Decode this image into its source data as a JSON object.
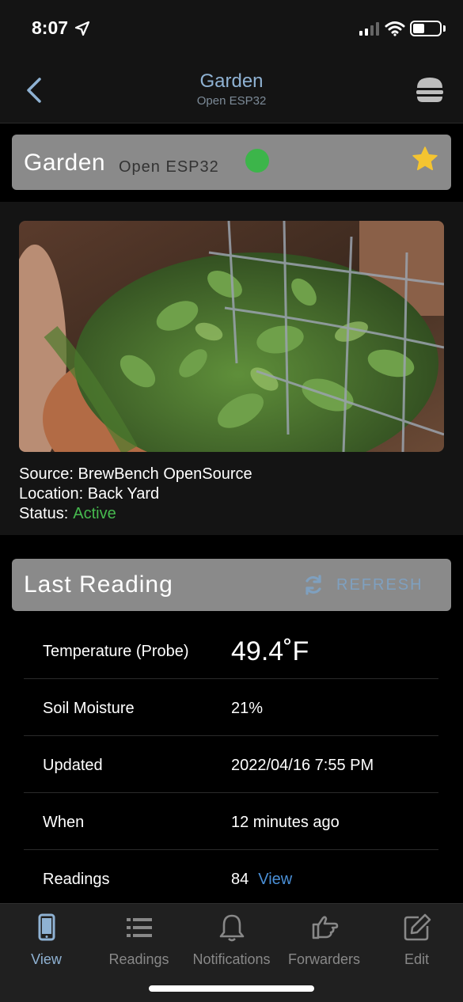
{
  "status_bar": {
    "time": "8:07"
  },
  "navbar": {
    "title": "Garden",
    "subtitle": "Open ESP32"
  },
  "device": {
    "name": "Garden",
    "type": "Open ESP32",
    "online_color": "#3cb54a",
    "favorite": true
  },
  "info": {
    "source_label": "Source:",
    "source": "BrewBench OpenSource",
    "location_label": "Location:",
    "location": "Back Yard",
    "status_label": "Status:",
    "status": "Active"
  },
  "last_reading": {
    "title": "Last Reading",
    "refresh_label": "REFRESH",
    "rows": [
      {
        "label": "Temperature (Probe)",
        "value": "49.4˚F"
      },
      {
        "label": "Soil Moisture",
        "value": "21%"
      },
      {
        "label": "Updated",
        "value": "2022/04/16 7:55 PM"
      },
      {
        "label": "When",
        "value": "12 minutes ago"
      },
      {
        "label": "Readings",
        "value": "84",
        "link": "View"
      }
    ]
  },
  "tabs": [
    {
      "label": "View",
      "icon": "phone-icon",
      "active": true
    },
    {
      "label": "Readings",
      "icon": "list-icon"
    },
    {
      "label": "Notifications",
      "icon": "bell-icon"
    },
    {
      "label": "Forwarders",
      "icon": "hand-point-icon"
    },
    {
      "label": "Edit",
      "icon": "edit-icon"
    }
  ],
  "colors": {
    "accent": "#8fb2d3",
    "link": "#4a8fd6",
    "active": "#46b94e",
    "star": "#f4c430"
  }
}
